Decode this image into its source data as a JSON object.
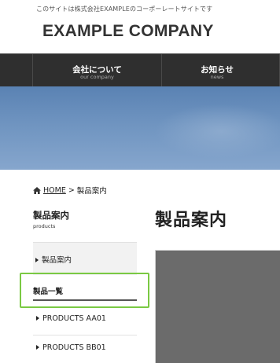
{
  "header": {
    "tagline": "このサイトは株式会社EXAMPLEのコーポーレートサイトです",
    "logo": "EXAMPLE COMPANY"
  },
  "global_nav": [
    {
      "label": "会社について",
      "sub": "our company"
    },
    {
      "label": "お知らせ",
      "sub": "news"
    }
  ],
  "breadcrumb": {
    "home": "HOME",
    "separator": ">",
    "current": "製品案内"
  },
  "sidebar": {
    "title": "製品案内",
    "subtitle": "products",
    "items": [
      {
        "label": "製品案内"
      },
      {
        "label": "製品一覧"
      },
      {
        "label": "PRODUCTS AA01"
      },
      {
        "label": "PRODUCTS BB01"
      }
    ]
  },
  "main": {
    "title": "製品案内"
  },
  "colors": {
    "nav_bg": "#2f2f2f",
    "highlight": "#7ac943",
    "hero_sky": "#6f94c0"
  }
}
